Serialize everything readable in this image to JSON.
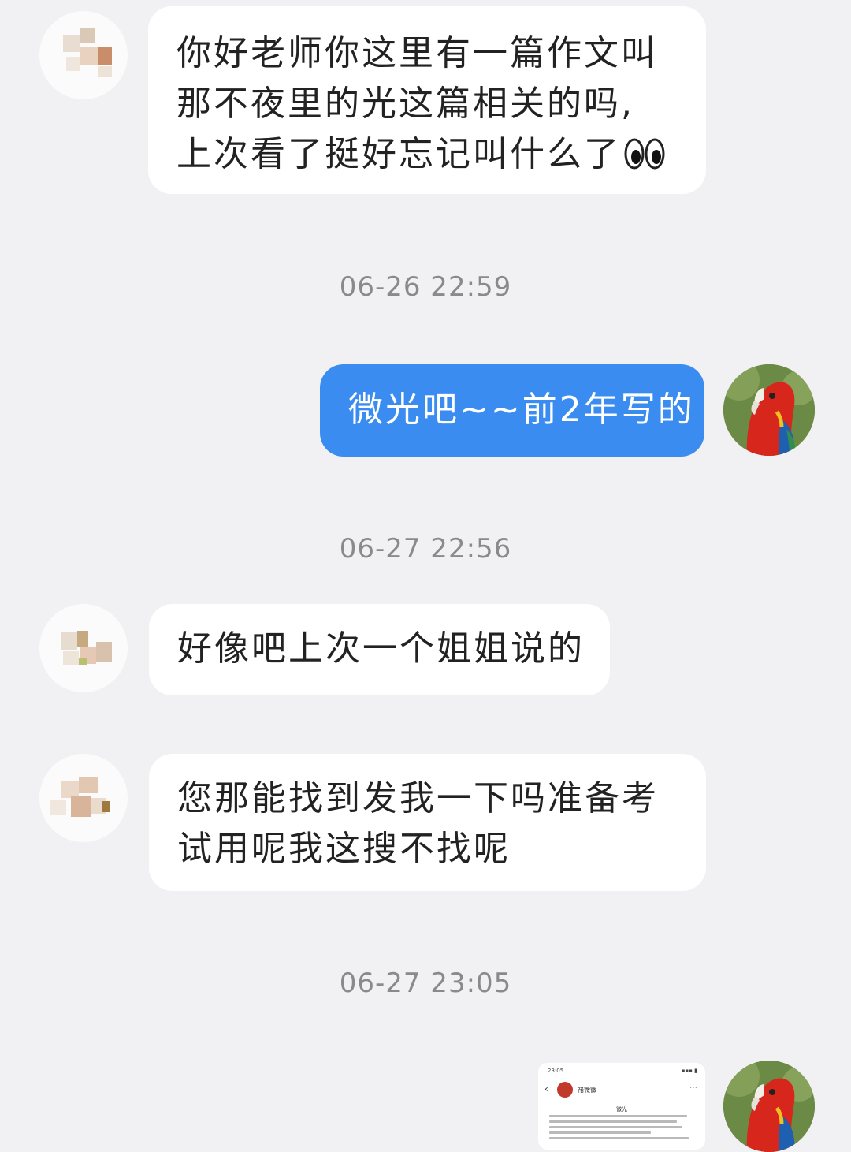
{
  "messages": [
    {
      "side": "in",
      "text_lines": [
        "你好老师你这里有一篇作文叫",
        "那不夜里的光这篇相关的吗,",
        "上次看了挺好忘记叫什么了"
      ],
      "emoji": "eyes-emoji"
    },
    {
      "timestamp": "06-26 22:59"
    },
    {
      "side": "out",
      "text": "微光吧~~前2年写的"
    },
    {
      "timestamp": "06-27 22:56"
    },
    {
      "side": "in",
      "text": "好像吧上次一个姐姐说的"
    },
    {
      "side": "in",
      "text_lines": [
        "您那能找到发我一下吗准备考",
        "试用呢我这搜不找呢"
      ]
    },
    {
      "timestamp": "06-27 23:05"
    }
  ],
  "msg1": {
    "line1": "你好老师你这里有一篇作文叫",
    "line2": "那不夜里的光这篇相关的吗,",
    "line3": "上次看了挺好忘记叫什么了"
  },
  "ts1": "06-26 22:59",
  "msg2": "微光吧~~前2年写的",
  "ts2": "06-27 22:56",
  "msg3": "好像吧上次一个姐姐说的",
  "msg4": {
    "line1": "您那能找到发我一下吗准备考",
    "line2": "试用呢我这搜不找呢"
  },
  "ts3": "06-27 23:05",
  "thumbnail": {
    "status_time": "23:05",
    "contact_name": "褚微微",
    "doc_title": "微光"
  },
  "colors": {
    "background": "#f1f1f3",
    "outgoing_bubble": "#3a8cf0",
    "incoming_bubble": "#ffffff",
    "timestamp": "#8a8a8e"
  }
}
